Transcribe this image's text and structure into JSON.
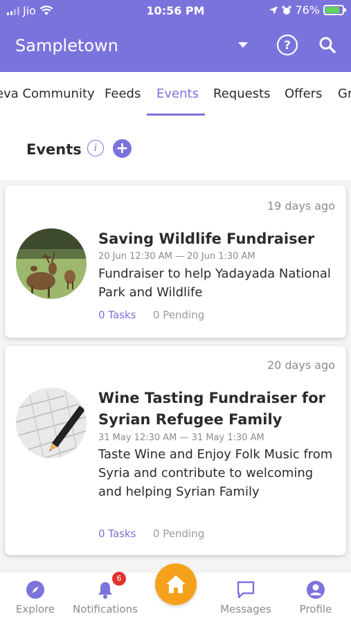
{
  "status_bar": {
    "carrier": "Jio",
    "time": "10:56 PM",
    "battery": "76%",
    "battery_level": 0.76
  },
  "header": {
    "title": "Sampletown",
    "accent_color": "#7b73dc"
  },
  "tabs": [
    {
      "label": "eva Community"
    },
    {
      "label": "Feeds"
    },
    {
      "label": "Events",
      "active": true
    },
    {
      "label": "Requests"
    },
    {
      "label": "Offers"
    },
    {
      "label": "Gr"
    }
  ],
  "section": {
    "title": "Events"
  },
  "events": [
    {
      "ago": "19 days ago",
      "title": "Saving Wildlife Fundraiser",
      "dates": "20 Jun 12:30 AM  — 20 Jun 1:30 AM",
      "description": "Fundraiser to help Yadayada National Park and Wildlife",
      "tasks": "0 Tasks",
      "pending": "0 Pending"
    },
    {
      "ago": "20 days ago",
      "title": "Wine Tasting Fundraiser for Syrian Refugee Family",
      "dates": "31 May 12:30 AM  — 31 May 1:30 AM",
      "description": "Taste Wine and Enjoy Folk Music from Syria and contribute to welcoming and helping Syrian Family",
      "tasks": "0 Tasks",
      "pending": "0 Pending"
    }
  ],
  "bottom_nav": {
    "explore": "Explore",
    "notifications": "Notifications",
    "notifications_badge": "6",
    "messages": "Messages",
    "profile": "Profile",
    "home_color": "#f6a11b"
  }
}
